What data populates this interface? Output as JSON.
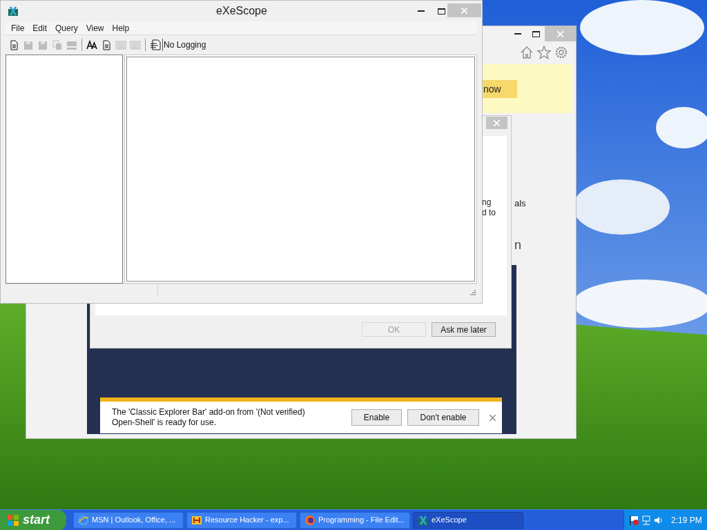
{
  "ie_window": {
    "notification_button": "now",
    "page_fragments": [
      "als",
      "n"
    ]
  },
  "dialog": {
    "content_fragments": [
      "ng",
      "d to"
    ],
    "buttons": [
      {
        "label": "OK",
        "disabled": true
      },
      {
        "label": "Ask me later",
        "disabled": false
      }
    ]
  },
  "addon_bar": {
    "message": "The 'Classic Explorer Bar' add-on from '(Not verified) Open-Shell' is ready for use.",
    "buttons": [
      "Enable",
      "Don't enable"
    ]
  },
  "exescope": {
    "title": "eXeScope",
    "menu": [
      "File",
      "Edit",
      "Query",
      "View",
      "Help"
    ],
    "toolbar": [
      {
        "kind": "page",
        "disabled": false
      },
      {
        "kind": "disk",
        "disabled": true
      },
      {
        "kind": "disk",
        "disabled": true
      },
      {
        "kind": "copy",
        "disabled": true
      },
      {
        "kind": "block",
        "disabled": true
      },
      {
        "kind": "separator"
      },
      {
        "kind": "font",
        "disabled": false
      },
      {
        "kind": "page",
        "disabled": false
      },
      {
        "kind": "grid",
        "disabled": true
      },
      {
        "kind": "grid",
        "disabled": true
      },
      {
        "kind": "separator"
      },
      {
        "kind": "log",
        "disabled": false
      }
    ],
    "logging": "No Logging"
  },
  "taskbar": {
    "start": "start",
    "tasks": [
      {
        "label": "MSN | Outlook, Office, ...",
        "selected": false
      },
      {
        "label": "Resource Hacker - exp...",
        "selected": false
      },
      {
        "label": "Programming - File Edit...",
        "selected": false
      },
      {
        "label": "eXeScope",
        "selected": true
      }
    ],
    "clock": "2:19 PM"
  }
}
